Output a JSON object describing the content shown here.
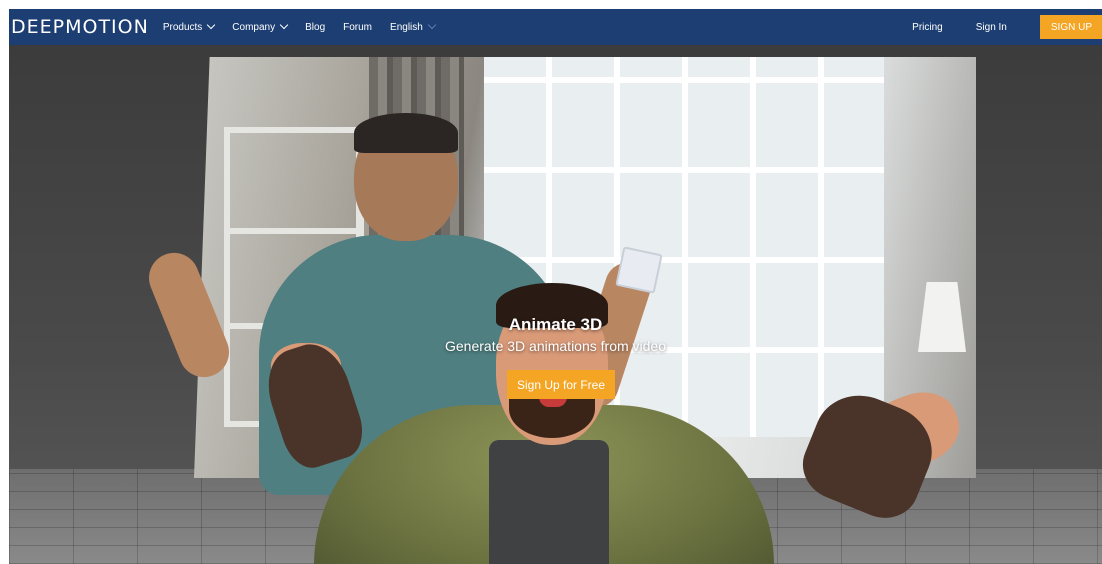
{
  "header": {
    "logo_text": "DEEPMOTION",
    "nav_left": [
      {
        "label": "Products",
        "has_dropdown": true
      },
      {
        "label": "Company",
        "has_dropdown": true
      },
      {
        "label": "Blog",
        "has_dropdown": false
      },
      {
        "label": "Forum",
        "has_dropdown": false
      },
      {
        "label": "English",
        "has_dropdown": true
      }
    ],
    "nav_right": {
      "pricing": "Pricing",
      "sign_in": "Sign In",
      "sign_up": "SIGN UP"
    }
  },
  "hero": {
    "title": "Animate 3D",
    "subtitle": "Generate 3D animations from video",
    "cta_label": "Sign Up for Free"
  },
  "colors": {
    "nav_background": "#1d3e72",
    "accent": "#f5a524",
    "text_on_dark": "#ffffff"
  },
  "icons": {
    "dropdown": "chevron-down-icon"
  }
}
